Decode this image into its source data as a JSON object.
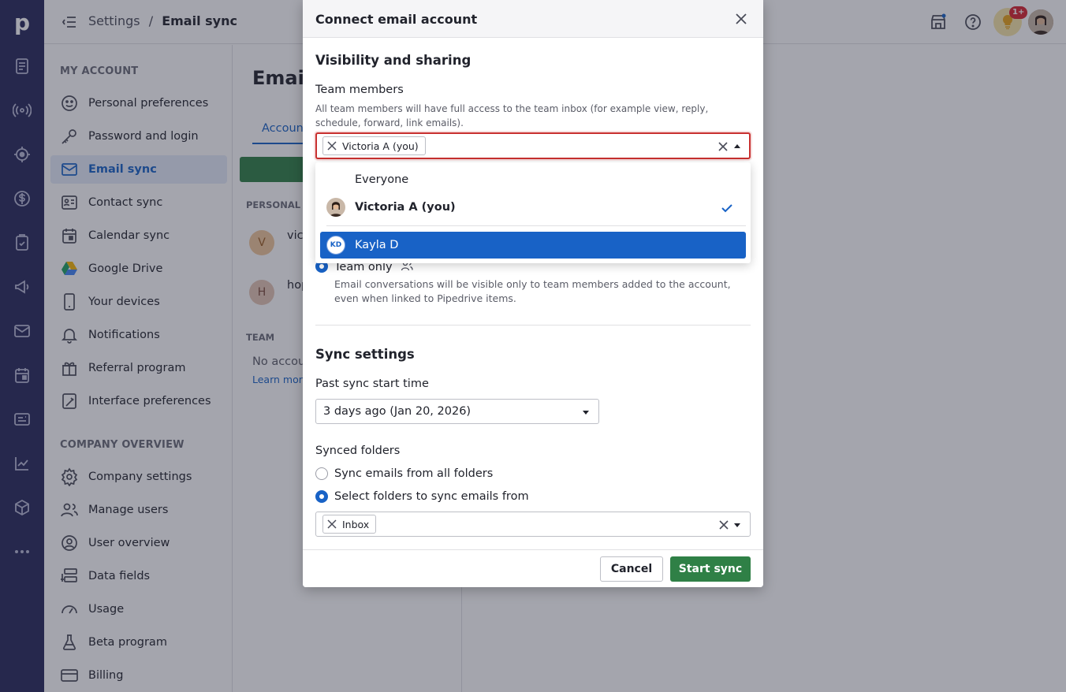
{
  "app": {
    "logo_letter": "p"
  },
  "topbar": {
    "breadcrumb_parent": "Settings",
    "breadcrumb_sep": "/",
    "breadcrumb_current": "Email sync",
    "notification_badge": "1+"
  },
  "sidebar": {
    "section_account": "MY ACCOUNT",
    "section_company": "COMPANY OVERVIEW",
    "account_items": [
      {
        "label": "Personal preferences",
        "icon": "smiley-icon"
      },
      {
        "label": "Password and login",
        "icon": "key-icon"
      },
      {
        "label": "Email sync",
        "icon": "mail-icon"
      },
      {
        "label": "Contact sync",
        "icon": "contact-card-icon"
      },
      {
        "label": "Calendar sync",
        "icon": "calendar-icon"
      },
      {
        "label": "Google Drive",
        "icon": "google-drive-icon"
      },
      {
        "label": "Your devices",
        "icon": "phone-icon"
      },
      {
        "label": "Notifications",
        "icon": "bell-icon"
      },
      {
        "label": "Referral program",
        "icon": "gift-icon"
      },
      {
        "label": "Interface preferences",
        "icon": "interface-icon"
      }
    ],
    "company_items": [
      {
        "label": "Company settings",
        "icon": "gear-icon"
      },
      {
        "label": "Manage users",
        "icon": "users-icon"
      },
      {
        "label": "User overview",
        "icon": "user-circle-icon"
      },
      {
        "label": "Data fields",
        "icon": "data-fields-icon"
      },
      {
        "label": "Usage",
        "icon": "gauge-icon"
      },
      {
        "label": "Beta program",
        "icon": "flask-icon"
      },
      {
        "label": "Billing",
        "icon": "card-icon"
      }
    ]
  },
  "main": {
    "title": "Email",
    "tab": "Account",
    "personal_label": "PERSONAL",
    "team_label": "TEAM",
    "account1_initial": "V",
    "account1_text": "vic",
    "account2_initial": "H",
    "account2_text": "hop",
    "no_accounts": "No accou",
    "learn_more": "Learn more"
  },
  "dialog": {
    "title": "Connect email account",
    "visibility_heading": "Visibility and sharing",
    "team_members_label": "Team members",
    "team_members_help": "All team members will have full access to the team inbox (for example view, reply, schedule, forward, link emails).",
    "selected_chip": "Victoria A (you)",
    "team_only_label": "Team only",
    "team_only_help": "Email conversations will be visible only to team members added to the account, even when linked to Pipedrive items.",
    "sync_heading": "Sync settings",
    "past_sync_label": "Past sync start time",
    "past_sync_value": "3 days ago (Jan 20, 2026)",
    "synced_folders_label": "Synced folders",
    "option_all_folders": "Sync emails from all folders",
    "option_select_folders": "Select folders to sync emails from",
    "folder_chip": "Inbox",
    "cancel_label": "Cancel",
    "start_label": "Start sync"
  },
  "dropdown": {
    "options": [
      {
        "label": "Everyone"
      },
      {
        "label": "Victoria A (you)",
        "selected": true
      },
      {
        "label": "Kayla D",
        "initials": "KD",
        "highlighted": true
      }
    ]
  },
  "colors": {
    "rail": "#26285b",
    "accent": "#1862c6",
    "primary_button": "#2f8046",
    "error": "#c8302f"
  }
}
